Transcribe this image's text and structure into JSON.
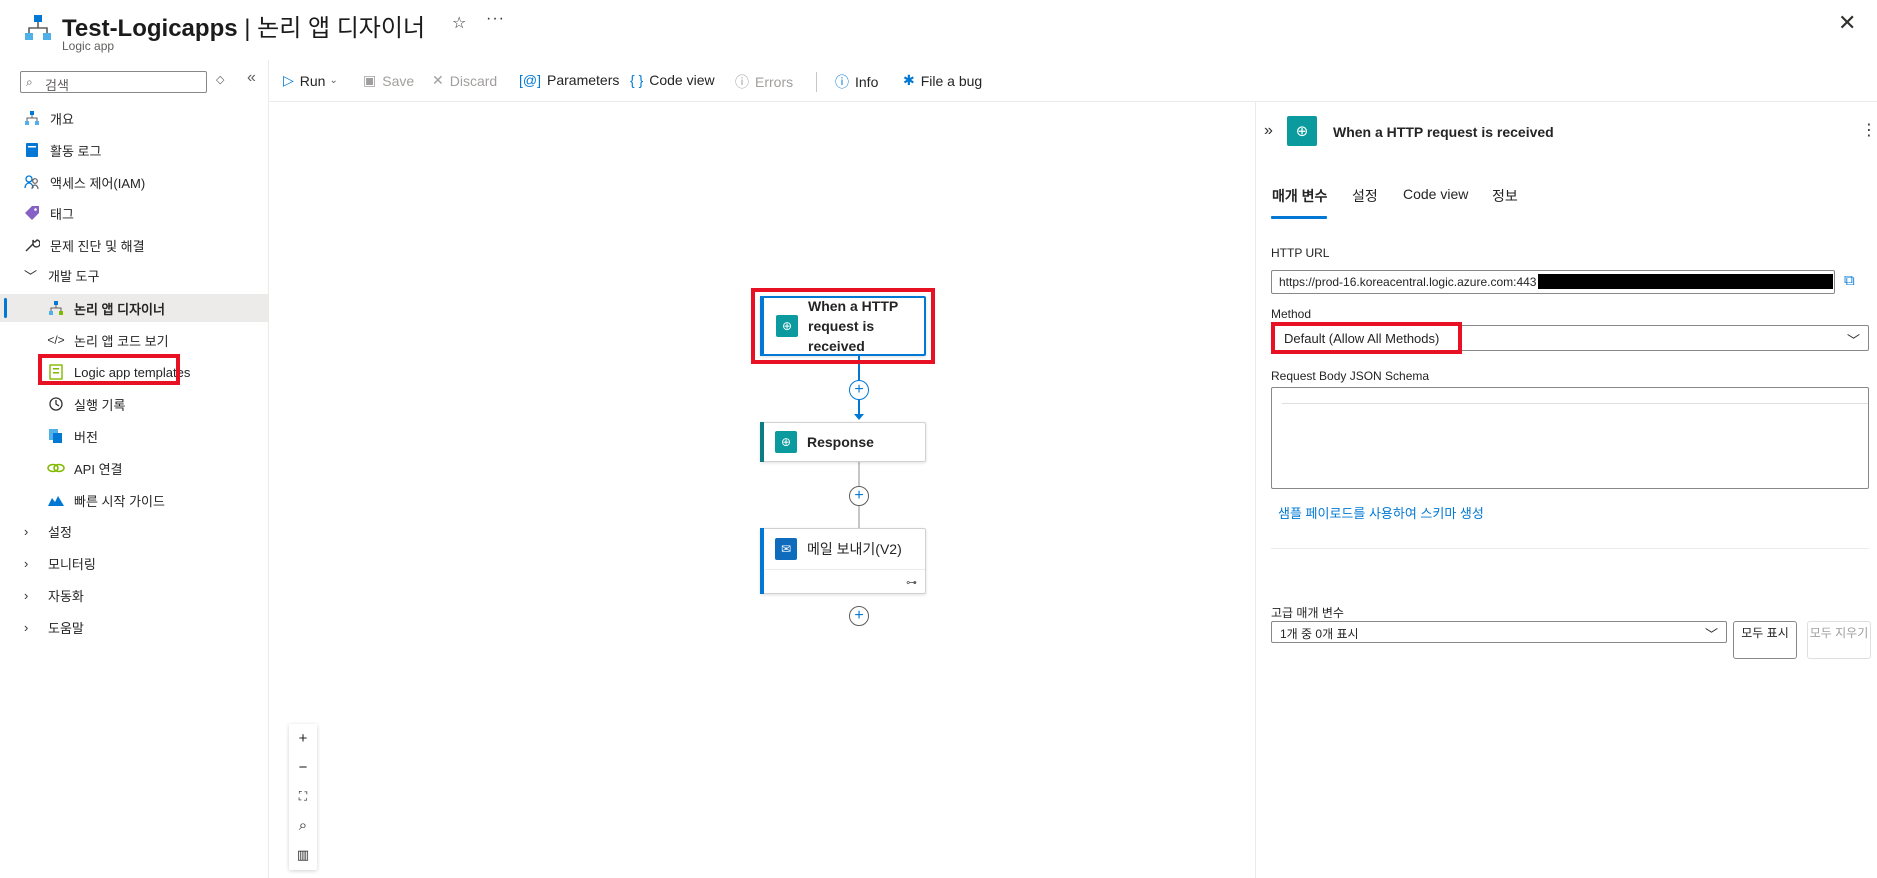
{
  "header": {
    "title": "Test-Logicapps",
    "separator": " | ",
    "title_suffix": "논리 앱 디자이너",
    "subtitle": "Logic app",
    "star": "☆",
    "more": "···",
    "close": "✕"
  },
  "sidebar": {
    "search_placeholder": "검색",
    "items": [
      {
        "label": "개요",
        "icon": "logic-app-icon"
      },
      {
        "label": "활동 로그",
        "icon": "activity-log-icon"
      },
      {
        "label": "액세스 제어(IAM)",
        "icon": "people-icon"
      },
      {
        "label": "태그",
        "icon": "tag-icon"
      },
      {
        "label": "문제 진단 및 해결",
        "icon": "wrench-icon"
      }
    ],
    "dev_group": {
      "label": "개발 도구",
      "items": [
        {
          "label": "논리 앱 디자이너",
          "icon": "designer-icon",
          "selected": true
        },
        {
          "label": "논리 앱 코드 보기",
          "icon": "code-icon"
        },
        {
          "label": "Logic app templates",
          "icon": "template-icon"
        },
        {
          "label": "실행 기록",
          "icon": "history-icon"
        },
        {
          "label": "버전",
          "icon": "versions-icon"
        },
        {
          "label": "API 연결",
          "icon": "api-connection-icon"
        },
        {
          "label": "빠른 시작 가이드",
          "icon": "quickstart-icon"
        }
      ]
    },
    "groups": [
      "설정",
      "모니터링",
      "자동화",
      "도움말"
    ]
  },
  "toolbar": {
    "run": "Run",
    "save": "Save",
    "discard": "Discard",
    "parameters": "Parameters",
    "code_view": "Code view",
    "errors": "Errors",
    "info": "Info",
    "file_bug": "File a bug"
  },
  "canvas": {
    "trigger_label": "When a HTTP request is received",
    "response_label": "Response",
    "mail_label": "메일 보내기(V2)"
  },
  "panel": {
    "title": "When a HTTP request is received",
    "tabs": [
      "매개 변수",
      "설정",
      "Code view",
      "정보"
    ],
    "http_url_label": "HTTP URL",
    "http_url_value": "https://prod-16.koreacentral.logic.azure.com:443",
    "method_label": "Method",
    "method_value": "Default (Allow All Methods)",
    "schema_label": "Request Body JSON Schema",
    "schema_link": "샘플 페이로드를 사용하여 스키마 생성",
    "advanced_label": "고급 매개 변수",
    "advanced_value": "1개 중 0개 표시",
    "show_all": "모두 표시",
    "clear_all": "모두 지우기"
  },
  "colors": {
    "accent": "#0078d4",
    "highlight": "#e81123",
    "teal": "#0b9a9e"
  }
}
